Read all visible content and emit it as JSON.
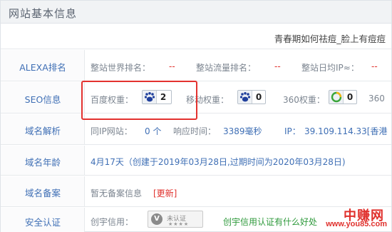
{
  "panel": {
    "title": "网站基本信息"
  },
  "site": {
    "title": "青春期如何祛痘_脸上有痘痘"
  },
  "rows": {
    "alexa": {
      "label": "ALEXA排名",
      "world_rank_label": "整站世界排名：",
      "world_rank_value": "--",
      "traffic_rank_label": "整站流量排名：",
      "traffic_rank_value": "--",
      "daily_ip_label": "整站日均IP≈：",
      "daily_ip_value": "--"
    },
    "seo": {
      "label": "SEO信息",
      "baidu_label": "百度权重：",
      "baidu_value": "2",
      "mobile_label": "移动权重：",
      "mobile_value": "0",
      "so360_label": "360权重：",
      "so360_value": "0",
      "cut_label": "360"
    },
    "dns": {
      "label": "域名解析",
      "same_ip_label": "同IP网站：",
      "same_ip_value": "0 个",
      "resp_label": "响应时间：",
      "resp_value": "3389毫秒",
      "ip_label": "IP：",
      "ip_value": "39.109.114.33[香港"
    },
    "age": {
      "label": "域名年龄",
      "value": "4月17天（创建于2019年03月28日,过期时间为2020年03月28日)"
    },
    "icp": {
      "label": "域名备案",
      "value": "暂无备案信息",
      "refresh": "[更新]"
    },
    "cert": {
      "label": "安全认证",
      "credit_label": "创宇信用：",
      "badge_text": "未认证",
      "badge_v": "V",
      "badge_stars": "★★★★",
      "link": "创宇信用认证有什么好处"
    }
  },
  "watermark": {
    "cn": "中赚网",
    "url": "www.you85.com"
  },
  "colors": {
    "accent_blue": "#3f6fb5",
    "alert_red": "#e0302c",
    "green_link": "#2f9a3c"
  },
  "icons": {
    "baidu": "baidu-paw-icon",
    "mobile": "mobile-paw-icon",
    "so360": "360-ring-icon"
  }
}
